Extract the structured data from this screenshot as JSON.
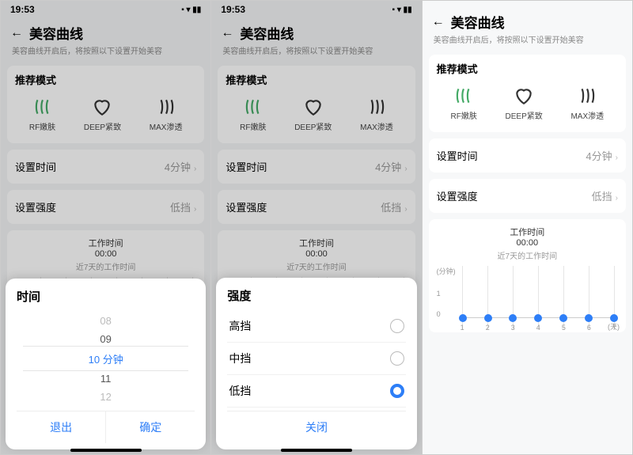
{
  "status": {
    "time": "19:53"
  },
  "nav": {
    "title": "美容曲线",
    "subtitle": "美容曲线开启后，将按照以下设置开始美容"
  },
  "modes": {
    "header": "推荐模式",
    "items": [
      {
        "label": "RF嫩肤"
      },
      {
        "label": "DEEP紧致"
      },
      {
        "label": "MAX渗透"
      }
    ]
  },
  "settings": {
    "time": {
      "label": "设置时间",
      "value": "4分钟"
    },
    "intensity": {
      "label": "设置强度",
      "value": "低挡"
    }
  },
  "chart": {
    "title": "工作时间",
    "value": "00:00",
    "subtitle": "近7天的工作时间",
    "ylabel": "(分钟)",
    "ymax": "1",
    "ymin": "0",
    "xunit": "(天)"
  },
  "chart_data": {
    "type": "bar",
    "categories": [
      "1",
      "2",
      "3",
      "4",
      "5",
      "6",
      "7"
    ],
    "values": [
      0,
      0,
      0,
      0,
      0,
      0,
      0
    ],
    "xlabel": "天",
    "ylabel": "分钟",
    "ylim": [
      0,
      1
    ],
    "title": "近7天的工作时间"
  },
  "time_sheet": {
    "title": "时间",
    "options": [
      "08",
      "09",
      "10 分钟",
      "11",
      "12"
    ],
    "cancel": "退出",
    "confirm": "确定"
  },
  "intensity_sheet": {
    "title": "强度",
    "options": [
      {
        "label": "高挡",
        "selected": false
      },
      {
        "label": "中挡",
        "selected": false
      },
      {
        "label": "低挡",
        "selected": true
      }
    ],
    "close": "关闭"
  }
}
